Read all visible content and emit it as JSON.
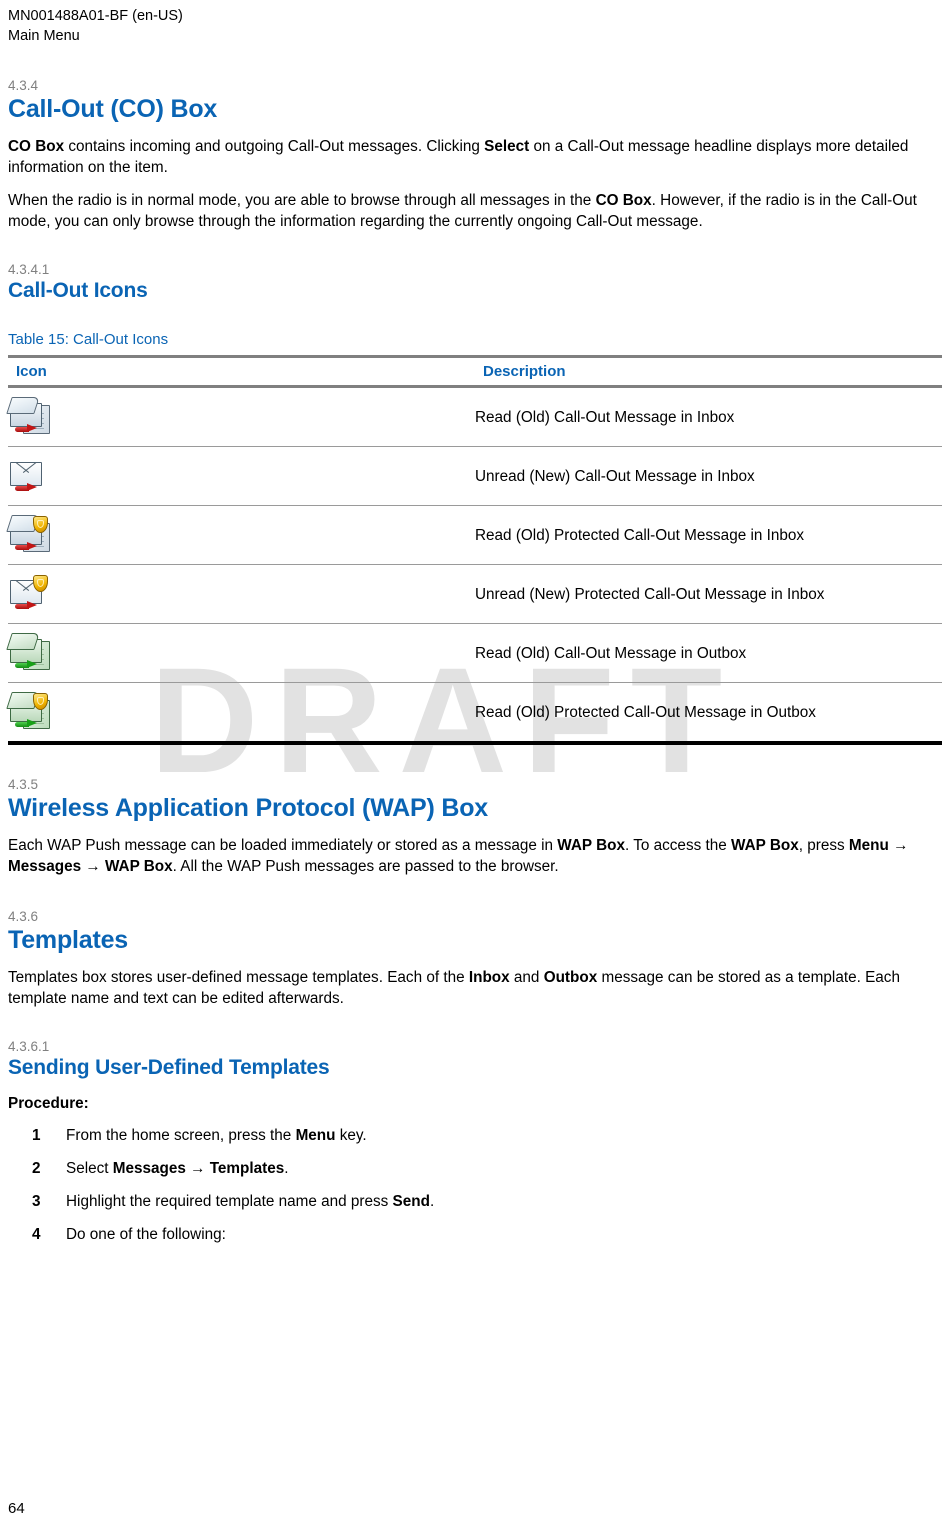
{
  "running_header": {
    "doc_id": "MN001488A01-BF (en-US)",
    "chapter": "Main Menu"
  },
  "watermark": "DRAFT",
  "colors": {
    "heading_blue": "#0a64b4",
    "section_number_gray": "#808080",
    "rule_gray": "#808080",
    "rule_black": "#000000",
    "watermark_gray": "#e2e2e2"
  },
  "sections": {
    "co_box": {
      "number": "4.3.4",
      "title": "Call-Out (CO) Box",
      "paragraphs": {
        "p1": {
          "lead_bold": "CO Box",
          "mid": " contains incoming and outgoing Call-Out messages. Clicking ",
          "bold2": "Select",
          "tail": " on a Call-Out message headline displays more detailed information on the item."
        },
        "p2": {
          "start": "When the radio is in normal mode, you are able to browse through all messages in the ",
          "bold1": "CO Box",
          "tail": ". However, if the radio is in the Call-Out mode, you can only browse through the information regarding the currently ongoing Call-Out message."
        }
      }
    },
    "call_out_icons": {
      "number": "4.3.4.1",
      "title": "Call-Out Icons",
      "table": {
        "caption": "Table 15: Call-Out Icons",
        "headers": [
          "Icon",
          "Description"
        ],
        "rows": [
          {
            "icon_name": "read-old-callout-inbox-icon",
            "description": "Read (Old) Call-Out Message in Inbox"
          },
          {
            "icon_name": "unread-new-callout-inbox-icon",
            "description": "Unread (New) Call-Out Message in Inbox"
          },
          {
            "icon_name": "read-old-protected-callout-inbox-icon",
            "description": "Read (Old) Protected Call-Out Message in Inbox"
          },
          {
            "icon_name": "unread-new-protected-callout-inbox-icon",
            "description": "Unread (New) Protected Call-Out Message in Inbox"
          },
          {
            "icon_name": "read-old-callout-outbox-icon",
            "description": "Read (Old) Call-Out Message in Outbox"
          },
          {
            "icon_name": "read-old-protected-callout-outbox-icon",
            "description": "Read (Old) Protected Call-Out Message in Outbox"
          }
        ]
      }
    },
    "wap_box": {
      "number": "4.3.5",
      "title": "Wireless Application Protocol (WAP) Box",
      "paragraph": {
        "s1": "Each WAP Push message can be loaded immediately or stored as a message in ",
        "b1": "WAP Box",
        "s2": ". To access the ",
        "b2": "WAP Box",
        "s3": ", press ",
        "b3": "Menu",
        "s4": " → ",
        "b4": "Messages",
        "s5": " → ",
        "b5": "WAP Box",
        "s6": ". All the WAP Push messages are passed to the browser."
      }
    },
    "templates": {
      "number": "4.3.6",
      "title": "Templates",
      "paragraph": {
        "s1": "Templates box stores user-defined message templates. Each of the ",
        "b1": "Inbox",
        "s2": " and ",
        "b2": "Outbox",
        "s3": " message can be stored as a template. Each template name and text can be edited afterwards."
      }
    },
    "sending_templates": {
      "number": "4.3.6.1",
      "title": "Sending User-Defined Templates",
      "procedure_label": "Procedure:",
      "steps": [
        {
          "num": "1",
          "s1": "From the home screen, press the ",
          "b1": "Menu",
          "s2": " key.",
          "b2": "",
          "s3": ""
        },
        {
          "num": "2",
          "s1": "Select ",
          "b1": "Messages",
          "s2": " → ",
          "b2": "Templates",
          "s3": "."
        },
        {
          "num": "3",
          "s1": "Highlight the required template name and press ",
          "b1": "Send",
          "s2": ".",
          "b2": "",
          "s3": ""
        },
        {
          "num": "4",
          "s1": "Do one of the following:",
          "b1": "",
          "s2": "",
          "b2": "",
          "s3": ""
        }
      ]
    }
  },
  "footer": {
    "page_number": "64"
  }
}
